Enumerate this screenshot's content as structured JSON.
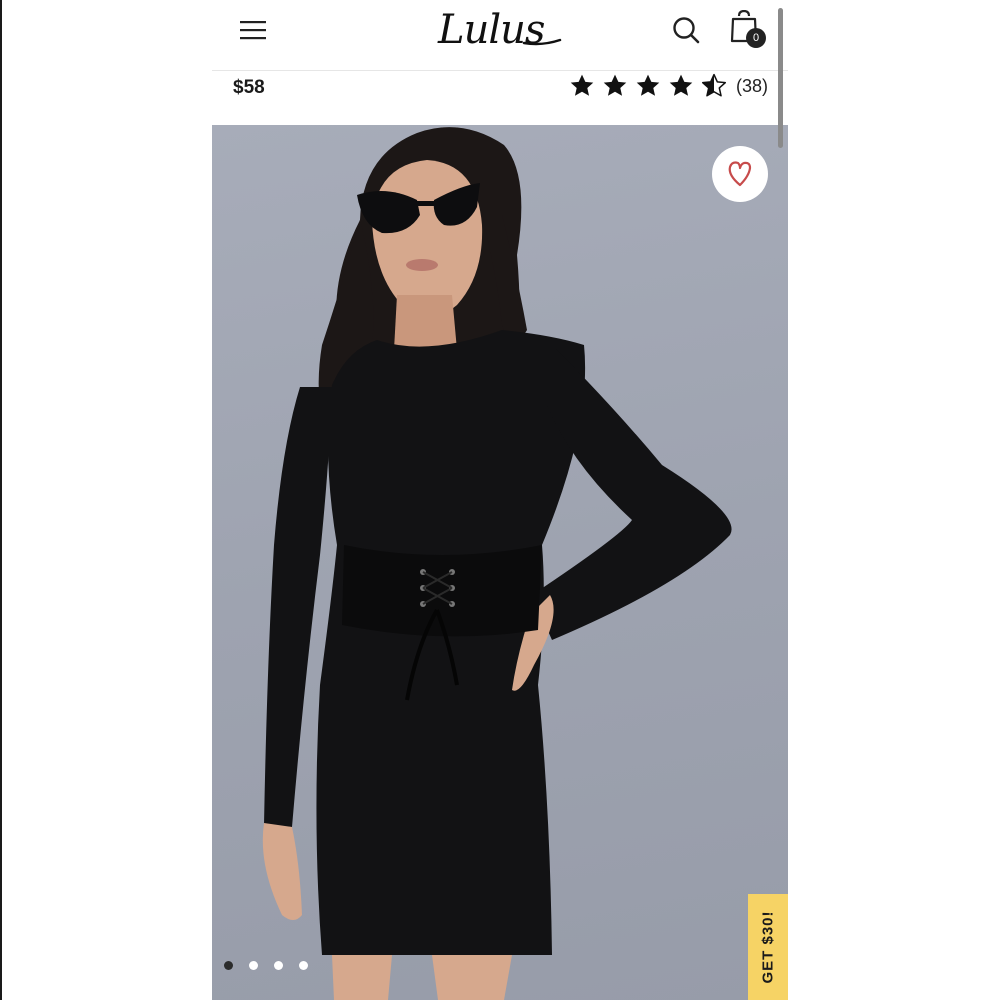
{
  "header": {
    "logo_text": "Lulus",
    "menu_icon": "hamburger-menu-icon",
    "search_icon": "search-icon",
    "bag_icon": "shopping-bag-icon",
    "bag_count": "0"
  },
  "product": {
    "price": "$58",
    "rating": {
      "stars": 4.5,
      "max": 5,
      "review_count": "(38)"
    }
  },
  "gallery": {
    "favorite_icon": "heart-icon",
    "image_count": 4,
    "active_index": 0
  },
  "promo": {
    "label": "GET $30!",
    "color": "#f6d365"
  },
  "colors": {
    "photo_background": "#9ea3b0",
    "text": "#1a1a1a",
    "heart": "#c74b4b"
  }
}
